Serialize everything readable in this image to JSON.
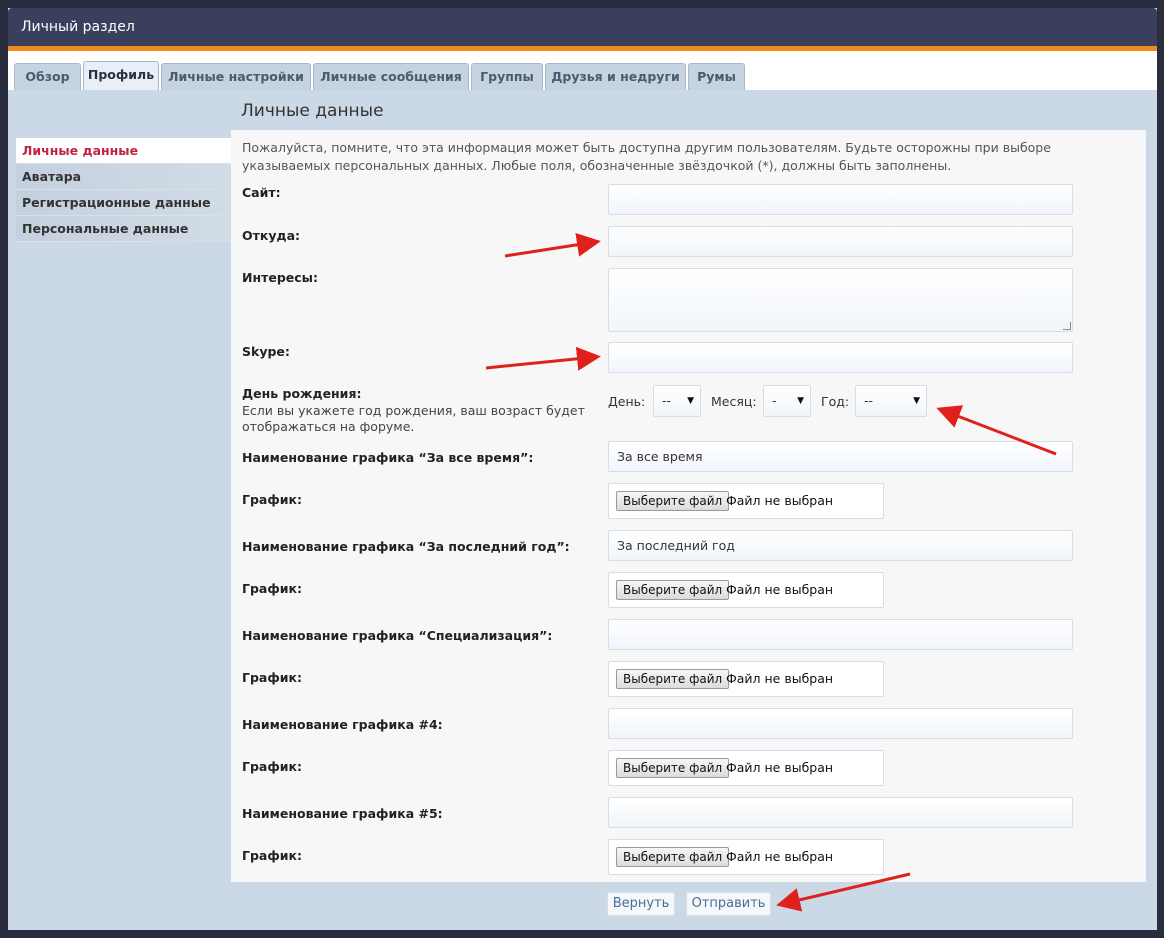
{
  "header": {
    "title": "Личный раздел"
  },
  "tabs": [
    {
      "label": "Обзор"
    },
    {
      "label": "Профиль"
    },
    {
      "label": "Личные настройки"
    },
    {
      "label": "Личные сообщения"
    },
    {
      "label": "Группы"
    },
    {
      "label": "Друзья и недруги"
    },
    {
      "label": "Румы"
    }
  ],
  "sidebar": {
    "items": [
      {
        "label": "Личные данные"
      },
      {
        "label": "Аватара"
      },
      {
        "label": "Регистрационные данные"
      },
      {
        "label": "Персональные данные"
      }
    ]
  },
  "page": {
    "title": "Личные данные",
    "note": "Пожалуйста, помните, что эта информация может быть доступна другим пользователям. Будьте осторожны при выборе указываемых персональных данных. Любые поля, обозначенные звёздочкой (*), должны быть заполнены."
  },
  "fields": {
    "site_label": "Сайт:",
    "from_label": "Откуда:",
    "interests_label": "Интересы:",
    "skype_label": "Skype:",
    "birthday_label": "День рождения:",
    "birthday_note": "Если вы укажете год рождения, ваш возраст будет отображаться на форуме.",
    "day_label": "День:",
    "day_value": "--",
    "month_label": "Месяц:",
    "month_value": "-",
    "year_label": "Год:",
    "year_value": "--",
    "chart1_label": "Наименование графика “За все время”:",
    "chart1_value": "За все время",
    "chart2_label": "Наименование графика “За последний год”:",
    "chart2_value": "За последний год",
    "chart3_label": "Наименование графика “Специализация”:",
    "chart3_value": "",
    "chart4_label": "Наименование графика #4:",
    "chart4_value": "",
    "chart5_label": "Наименование графика #5:",
    "chart5_value": "",
    "graph_label": "График:",
    "file_button": "Выберите файл",
    "file_status": "Файл не выбран"
  },
  "buttons": {
    "reset_label": "Вернуть",
    "submit_label": "Отправить"
  },
  "colors": {
    "header_bg": "#3a3f5e",
    "accent_orange": "#f08c1c",
    "active_side": "#c0243e",
    "arrow_red": "#e0201a"
  }
}
